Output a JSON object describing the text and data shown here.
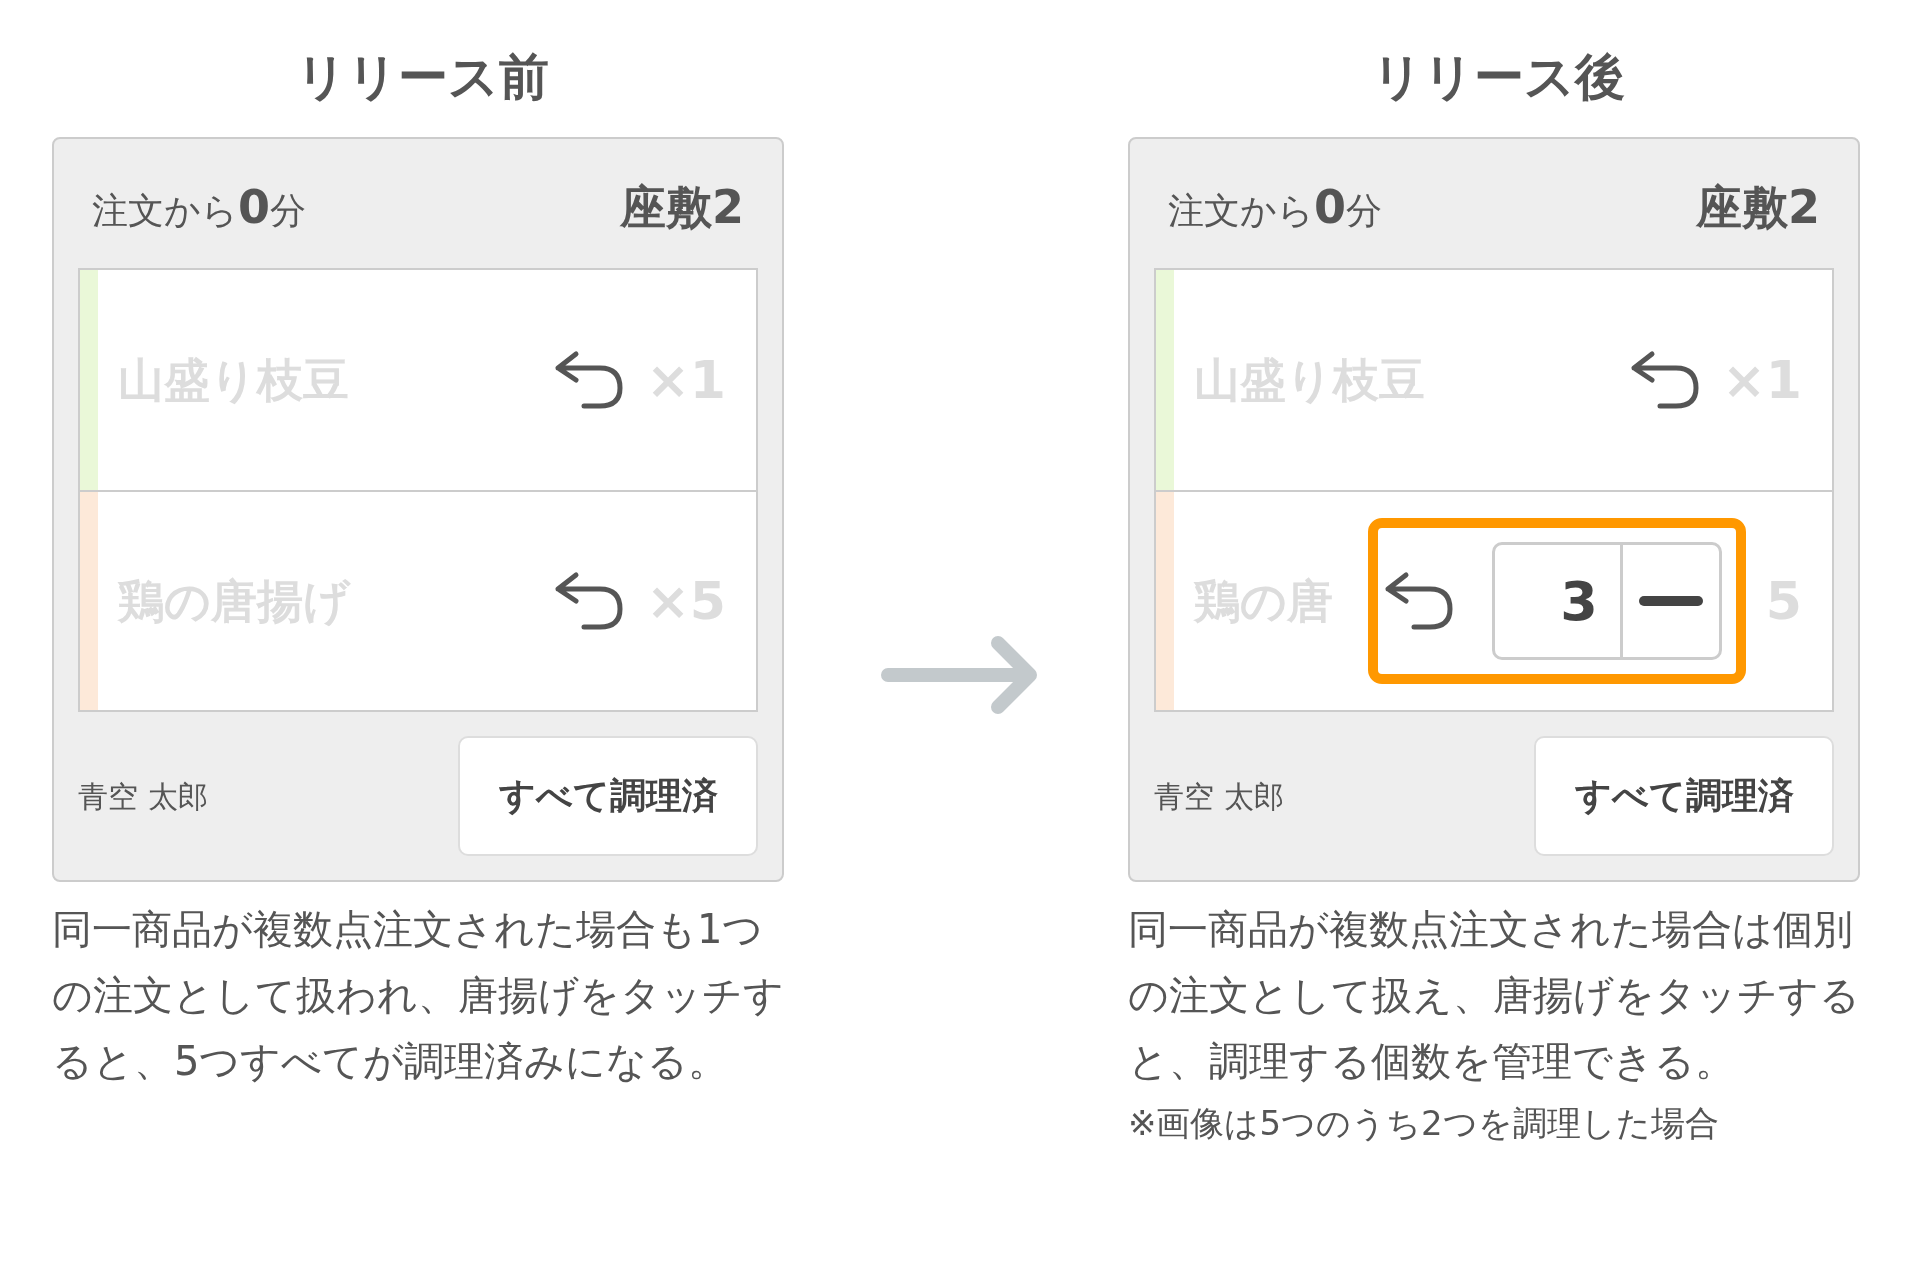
{
  "panels": [
    {
      "title": "リリース前",
      "card": {
        "elapsed_prefix": "注文から",
        "elapsed_value": "0",
        "elapsed_unit": "分",
        "table": "座敷2",
        "items": [
          {
            "name": "山盛り枝豆",
            "quantity": "×1",
            "color": "#eaf8d8"
          },
          {
            "name": "鶏の唐揚げ",
            "quantity": "×5",
            "color": "#fde9d9"
          }
        ],
        "staff": "青空 太郎",
        "button": "すべて調理済"
      },
      "caption": "同一商品が複数点注文された場合も1つの注文として扱われ、唐揚げをタッチすると、5つすべてが調理済みになる。"
    },
    {
      "title": "リリース後",
      "card": {
        "elapsed_prefix": "注文から",
        "elapsed_value": "0",
        "elapsed_unit": "分",
        "table": "座敷2",
        "items": [
          {
            "name": "山盛り枝豆",
            "quantity": "×1",
            "color": "#eaf8d8"
          },
          {
            "name": "鶏の唐",
            "quantity": "5",
            "color": "#fde9d9",
            "popup": {
              "stepper_value": "3"
            }
          }
        ],
        "staff": "青空 太郎",
        "button": "すべて調理済"
      },
      "caption": "同一商品が複数点注文された場合は個別の注文として扱え、唐揚げをタッチすると、調理する個数を管理できる。",
      "note": "※画像は5つのうち2つを調理した場合"
    }
  ]
}
